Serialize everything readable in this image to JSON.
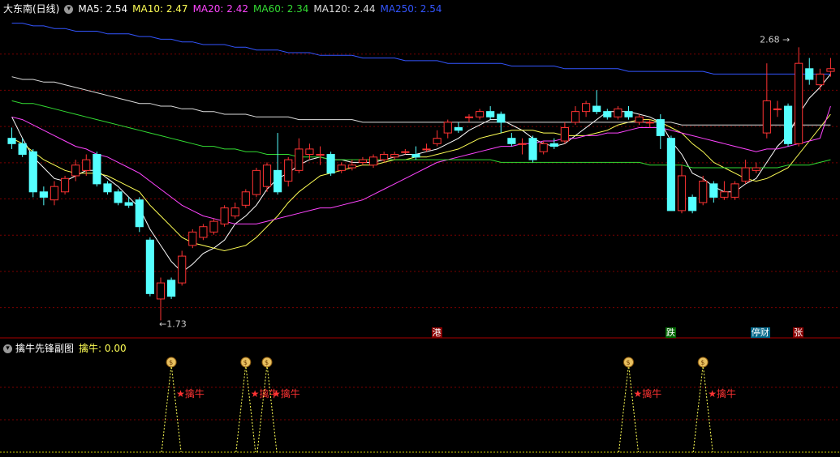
{
  "header": {
    "stock": "大东南(日线)",
    "ma": [
      {
        "label": "MA5: 2.54",
        "color": "#ffffff"
      },
      {
        "label": "MA10: 2.47",
        "color": "#ffff55"
      },
      {
        "label": "MA20: 2.42",
        "color": "#ff44ff"
      },
      {
        "label": "MA60: 2.34",
        "color": "#33dd33"
      },
      {
        "label": "MA120: 2.44",
        "color": "#dddddd"
      },
      {
        "label": "MA250: 2.54",
        "color": "#3355ff"
      }
    ]
  },
  "annotations": {
    "high": "2.68",
    "low": "1.73"
  },
  "events": [
    {
      "label": "港",
      "bg": "#880000",
      "color": "#ffffff"
    },
    {
      "label": "跌",
      "bg": "#006600",
      "color": "#ffffff"
    },
    {
      "label": "停财",
      "bg": "#006688",
      "color": "#ffffff"
    },
    {
      "label": "张",
      "bg": "#880000",
      "color": "#ffffff"
    }
  ],
  "indicator": {
    "title": "擒牛先锋副图",
    "value_label": "擒牛: 0.00",
    "signal_label": "★擒牛",
    "signal_icon": "money-bag-icon"
  },
  "colors": {
    "up": "#ff3333",
    "down": "#55ffff",
    "grid": "#7a0000",
    "ma5": "#ffffff",
    "ma10": "#ffff55",
    "ma20": "#ff44ff",
    "ma60": "#33dd33",
    "ma120": "#dddddd",
    "ma250": "#3355ff"
  },
  "chart_data": {
    "type": "candlestick",
    "ylim": [
      1.6,
      2.75
    ],
    "candles": [
      [
        2.3,
        2.28,
        2.34,
        2.26
      ],
      [
        2.28,
        2.24,
        2.3,
        2.23
      ],
      [
        2.25,
        2.1,
        2.26,
        2.08
      ],
      [
        2.1,
        2.08,
        2.12,
        2.05
      ],
      [
        2.07,
        2.12,
        2.14,
        2.05
      ],
      [
        2.1,
        2.15,
        2.16,
        2.09
      ],
      [
        2.16,
        2.2,
        2.22,
        2.14
      ],
      [
        2.18,
        2.22,
        2.24,
        2.16
      ],
      [
        2.24,
        2.13,
        2.25,
        2.12
      ],
      [
        2.13,
        2.1,
        2.14,
        2.09
      ],
      [
        2.1,
        2.06,
        2.11,
        2.05
      ],
      [
        2.06,
        2.05,
        2.08,
        2.04
      ],
      [
        2.07,
        1.97,
        2.08,
        1.95
      ],
      [
        1.92,
        1.72,
        1.93,
        1.71
      ],
      [
        1.7,
        1.76,
        1.78,
        1.62
      ],
      [
        1.77,
        1.71,
        1.78,
        1.7
      ],
      [
        1.76,
        1.86,
        1.88,
        1.75
      ],
      [
        1.9,
        1.95,
        1.96,
        1.89
      ],
      [
        1.93,
        1.97,
        1.98,
        1.92
      ],
      [
        1.95,
        1.99,
        2.0,
        1.94
      ],
      [
        1.98,
        2.04,
        2.05,
        1.97
      ],
      [
        2.01,
        2.04,
        2.06,
        2.0
      ],
      [
        2.05,
        2.1,
        2.11,
        2.04
      ],
      [
        2.09,
        2.18,
        2.19,
        2.08
      ],
      [
        2.12,
        2.2,
        2.21,
        2.1
      ],
      [
        2.18,
        2.1,
        2.32,
        2.09
      ],
      [
        2.14,
        2.22,
        2.23,
        2.12
      ],
      [
        2.18,
        2.26,
        2.3,
        2.17
      ],
      [
        2.24,
        2.26,
        2.28,
        2.22
      ],
      [
        2.24,
        2.24,
        2.27,
        2.2
      ],
      [
        2.24,
        2.17,
        2.25,
        2.16
      ],
      [
        2.18,
        2.2,
        2.21,
        2.17
      ],
      [
        2.19,
        2.2,
        2.22,
        2.18
      ],
      [
        2.21,
        2.22,
        2.23,
        2.2
      ],
      [
        2.2,
        2.23,
        2.24,
        2.19
      ],
      [
        2.22,
        2.24,
        2.25,
        2.21
      ],
      [
        2.23,
        2.24,
        2.25,
        2.22
      ],
      [
        2.25,
        2.25,
        2.26,
        2.24
      ],
      [
        2.24,
        2.23,
        2.27,
        2.22
      ],
      [
        2.26,
        2.26,
        2.28,
        2.25
      ],
      [
        2.28,
        2.3,
        2.33,
        2.27
      ],
      [
        2.32,
        2.36,
        2.37,
        2.3
      ],
      [
        2.34,
        2.33,
        2.36,
        2.32
      ],
      [
        2.38,
        2.38,
        2.39,
        2.36
      ],
      [
        2.38,
        2.4,
        2.41,
        2.37
      ],
      [
        2.4,
        2.38,
        2.42,
        2.37
      ],
      [
        2.39,
        2.36,
        2.4,
        2.32
      ],
      [
        2.3,
        2.28,
        2.32,
        2.27
      ],
      [
        2.28,
        2.28,
        2.3,
        2.24
      ],
      [
        2.3,
        2.22,
        2.31,
        2.21
      ],
      [
        2.25,
        2.28,
        2.29,
        2.24
      ],
      [
        2.28,
        2.27,
        2.3,
        2.26
      ],
      [
        2.29,
        2.34,
        2.36,
        2.28
      ],
      [
        2.36,
        2.4,
        2.42,
        2.35
      ],
      [
        2.4,
        2.43,
        2.44,
        2.38
      ],
      [
        2.42,
        2.4,
        2.48,
        2.39
      ],
      [
        2.4,
        2.38,
        2.41,
        2.37
      ],
      [
        2.38,
        2.41,
        2.42,
        2.37
      ],
      [
        2.4,
        2.38,
        2.42,
        2.37
      ],
      [
        2.36,
        2.38,
        2.39,
        2.35
      ],
      [
        2.36,
        2.36,
        2.37,
        2.34
      ],
      [
        2.37,
        2.31,
        2.39,
        2.26
      ],
      [
        2.3,
        2.03,
        2.31,
        2.03
      ],
      [
        2.03,
        2.16,
        2.2,
        2.02
      ],
      [
        2.08,
        2.03,
        2.09,
        2.02
      ],
      [
        2.06,
        2.14,
        2.16,
        2.05
      ],
      [
        2.13,
        2.08,
        2.14,
        2.06
      ],
      [
        2.08,
        2.1,
        2.14,
        2.07
      ],
      [
        2.08,
        2.13,
        2.14,
        2.07
      ],
      [
        2.14,
        2.19,
        2.22,
        2.13
      ],
      [
        2.18,
        2.19,
        2.21,
        2.17
      ],
      [
        2.32,
        2.44,
        2.58,
        2.3
      ],
      [
        2.41,
        2.41,
        2.44,
        2.38
      ],
      [
        2.42,
        2.28,
        2.43,
        2.27
      ],
      [
        2.28,
        2.58,
        2.64,
        2.27
      ],
      [
        2.56,
        2.52,
        2.6,
        2.5
      ],
      [
        2.5,
        2.54,
        2.56,
        2.48
      ],
      [
        2.55,
        2.56,
        2.6,
        2.53
      ]
    ],
    "ma_lines": [
      {
        "name": "MA5",
        "values": [
          2.38,
          2.3,
          2.23,
          2.19,
          2.15,
          2.14,
          2.16,
          2.18,
          2.18,
          2.15,
          2.12,
          2.08,
          2.04,
          1.96,
          1.9,
          1.84,
          1.8,
          1.83,
          1.87,
          1.89,
          1.92,
          1.98,
          2.01,
          2.05,
          2.11,
          2.15,
          2.17,
          2.2,
          2.22,
          2.23,
          2.22,
          2.22,
          2.21,
          2.21,
          2.21,
          2.22,
          2.23,
          2.24,
          2.24,
          2.25,
          2.26,
          2.28,
          2.3,
          2.33,
          2.35,
          2.37,
          2.37,
          2.35,
          2.33,
          2.3,
          2.28,
          2.27,
          2.28,
          2.31,
          2.34,
          2.37,
          2.4,
          2.4,
          2.4,
          2.39,
          2.38,
          2.36,
          2.29,
          2.24,
          2.17,
          2.15,
          2.12,
          2.1,
          2.1,
          2.13,
          2.15,
          2.21,
          2.27,
          2.31,
          2.39,
          2.45,
          2.49,
          2.54
        ]
      },
      {
        "name": "MA10",
        "values": [
          2.3,
          2.28,
          2.25,
          2.22,
          2.2,
          2.18,
          2.17,
          2.17,
          2.17,
          2.16,
          2.14,
          2.12,
          2.1,
          2.05,
          2.01,
          1.97,
          1.93,
          1.91,
          1.9,
          1.89,
          1.88,
          1.89,
          1.9,
          1.93,
          1.97,
          2.01,
          2.06,
          2.1,
          2.13,
          2.16,
          2.17,
          2.18,
          2.19,
          2.2,
          2.2,
          2.21,
          2.22,
          2.22,
          2.23,
          2.23,
          2.24,
          2.25,
          2.26,
          2.28,
          2.3,
          2.31,
          2.32,
          2.33,
          2.33,
          2.33,
          2.32,
          2.32,
          2.31,
          2.31,
          2.31,
          2.32,
          2.33,
          2.35,
          2.36,
          2.37,
          2.37,
          2.36,
          2.34,
          2.32,
          2.28,
          2.25,
          2.21,
          2.19,
          2.17,
          2.15,
          2.14,
          2.15,
          2.17,
          2.19,
          2.24,
          2.29,
          2.34,
          2.39
        ]
      },
      {
        "name": "MA20",
        "values": [
          2.38,
          2.37,
          2.35,
          2.33,
          2.31,
          2.29,
          2.27,
          2.26,
          2.24,
          2.23,
          2.21,
          2.19,
          2.17,
          2.14,
          2.11,
          2.08,
          2.05,
          2.03,
          2.01,
          2.0,
          1.99,
          1.98,
          1.98,
          1.98,
          1.99,
          2.0,
          2.01,
          2.02,
          2.03,
          2.04,
          2.04,
          2.05,
          2.06,
          2.07,
          2.09,
          2.11,
          2.13,
          2.15,
          2.17,
          2.19,
          2.21,
          2.22,
          2.23,
          2.24,
          2.25,
          2.26,
          2.27,
          2.27,
          2.28,
          2.28,
          2.29,
          2.29,
          2.3,
          2.3,
          2.31,
          2.31,
          2.32,
          2.32,
          2.33,
          2.34,
          2.34,
          2.34,
          2.33,
          2.32,
          2.31,
          2.3,
          2.29,
          2.28,
          2.27,
          2.26,
          2.25,
          2.26,
          2.26,
          2.27,
          2.28,
          2.29,
          2.3,
          2.42
        ]
      },
      {
        "name": "MA60",
        "values": [
          2.44,
          2.43,
          2.43,
          2.42,
          2.41,
          2.4,
          2.39,
          2.38,
          2.37,
          2.36,
          2.35,
          2.34,
          2.33,
          2.32,
          2.31,
          2.3,
          2.29,
          2.28,
          2.27,
          2.27,
          2.26,
          2.26,
          2.25,
          2.25,
          2.24,
          2.24,
          2.24,
          2.23,
          2.23,
          2.23,
          2.22,
          2.22,
          2.22,
          2.22,
          2.22,
          2.22,
          2.22,
          2.22,
          2.22,
          2.22,
          2.22,
          2.22,
          2.22,
          2.22,
          2.22,
          2.22,
          2.21,
          2.21,
          2.21,
          2.21,
          2.21,
          2.21,
          2.21,
          2.21,
          2.21,
          2.21,
          2.21,
          2.21,
          2.21,
          2.21,
          2.2,
          2.2,
          2.2,
          2.2,
          2.19,
          2.19,
          2.19,
          2.19,
          2.19,
          2.19,
          2.19,
          2.19,
          2.19,
          2.2,
          2.2,
          2.2,
          2.21,
          2.22
        ]
      },
      {
        "name": "MA120",
        "values": [
          2.53,
          2.52,
          2.52,
          2.51,
          2.51,
          2.5,
          2.49,
          2.48,
          2.47,
          2.46,
          2.45,
          2.44,
          2.43,
          2.43,
          2.42,
          2.42,
          2.41,
          2.41,
          2.4,
          2.4,
          2.39,
          2.39,
          2.39,
          2.38,
          2.38,
          2.38,
          2.38,
          2.37,
          2.37,
          2.37,
          2.37,
          2.37,
          2.37,
          2.36,
          2.36,
          2.36,
          2.36,
          2.36,
          2.36,
          2.36,
          2.36,
          2.36,
          2.36,
          2.36,
          2.36,
          2.36,
          2.36,
          2.36,
          2.36,
          2.36,
          2.36,
          2.36,
          2.36,
          2.36,
          2.36,
          2.36,
          2.36,
          2.36,
          2.36,
          2.36,
          2.36,
          2.36,
          2.36,
          2.35,
          2.35,
          2.35,
          2.35,
          2.35,
          2.35,
          2.35,
          2.35,
          2.35,
          2.35,
          2.35,
          2.35,
          2.35,
          2.35,
          2.35
        ]
      },
      {
        "name": "MA250",
        "values": [
          2.73,
          2.73,
          2.72,
          2.72,
          2.71,
          2.71,
          2.7,
          2.7,
          2.7,
          2.69,
          2.69,
          2.69,
          2.68,
          2.68,
          2.67,
          2.67,
          2.66,
          2.66,
          2.65,
          2.65,
          2.65,
          2.64,
          2.64,
          2.63,
          2.63,
          2.63,
          2.62,
          2.62,
          2.62,
          2.61,
          2.61,
          2.61,
          2.61,
          2.6,
          2.6,
          2.6,
          2.6,
          2.59,
          2.59,
          2.59,
          2.59,
          2.58,
          2.58,
          2.58,
          2.58,
          2.58,
          2.58,
          2.57,
          2.57,
          2.57,
          2.57,
          2.57,
          2.56,
          2.56,
          2.56,
          2.56,
          2.56,
          2.56,
          2.55,
          2.55,
          2.55,
          2.55,
          2.55,
          2.55,
          2.55,
          2.55,
          2.54,
          2.54,
          2.54,
          2.54,
          2.54,
          2.54,
          2.54,
          2.54,
          2.54,
          2.54,
          2.54,
          2.54
        ]
      }
    ],
    "signal_indices": [
      15,
      22,
      24,
      58,
      65
    ]
  }
}
